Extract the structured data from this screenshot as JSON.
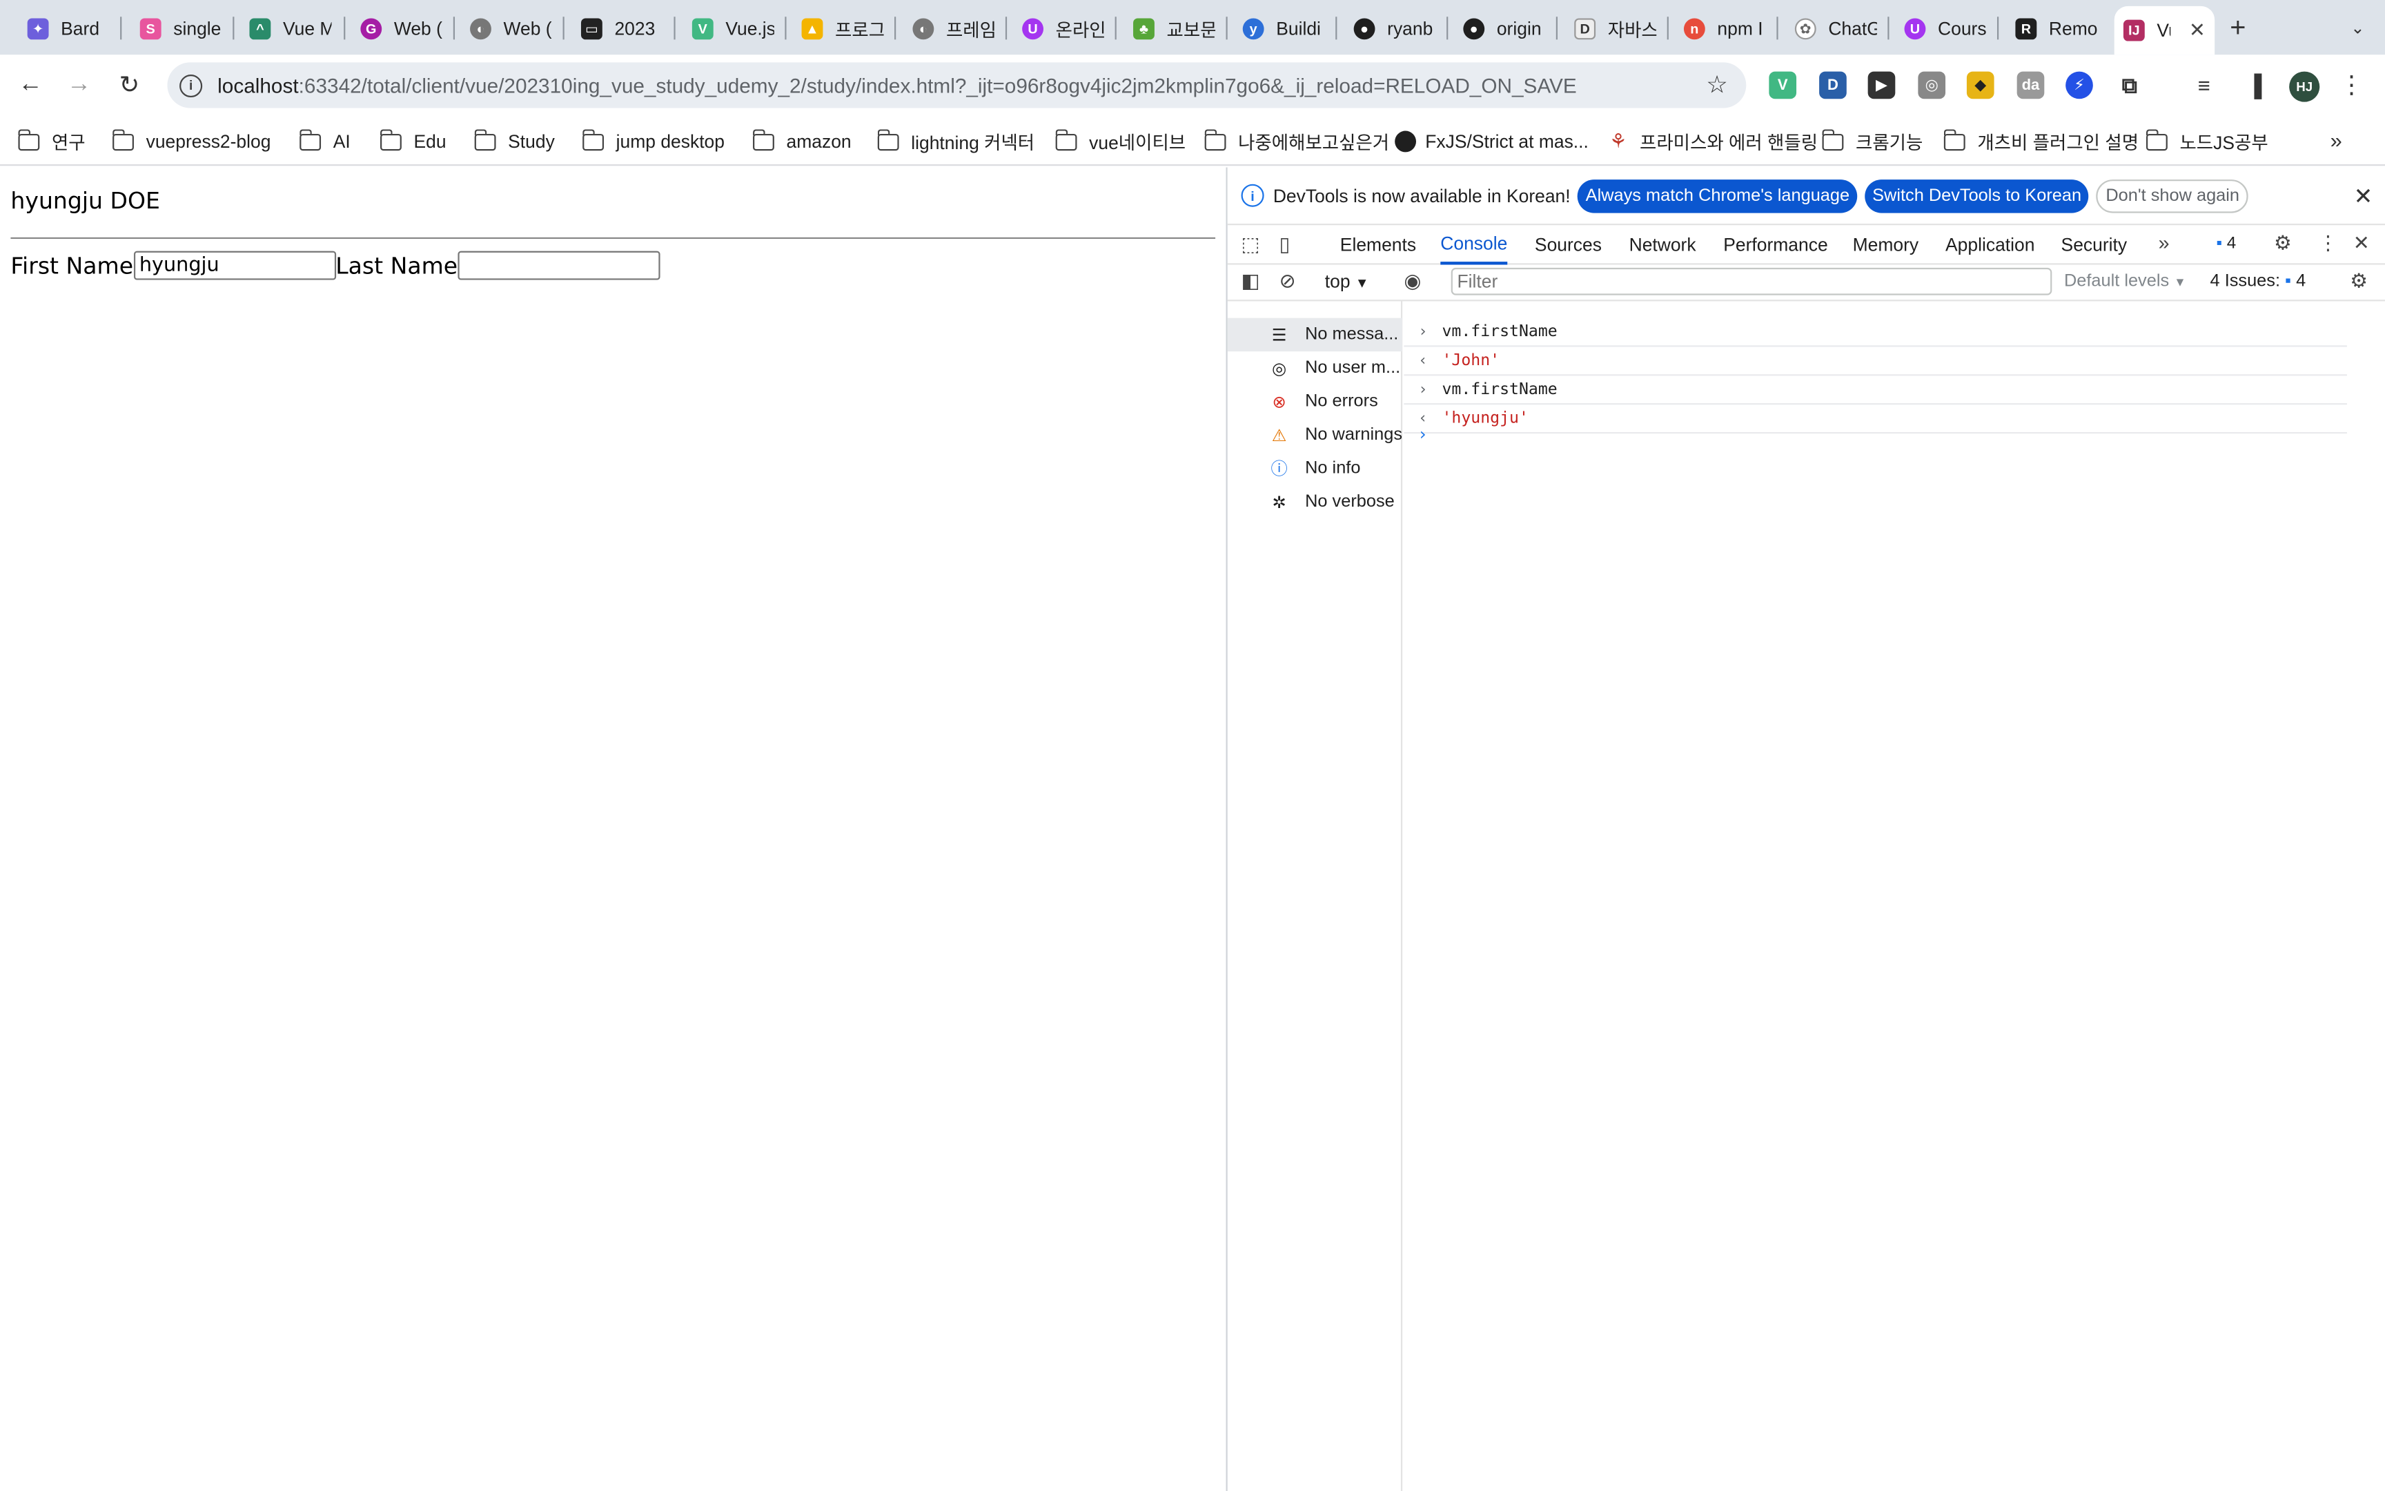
{
  "browser": {
    "tabs": [
      {
        "label": "Bard",
        "icon": "bard-icon",
        "color": "#6d5fdc"
      },
      {
        "label": "single",
        "icon": "single-spa-icon",
        "color": "#e8559e"
      },
      {
        "label": "Vue M",
        "icon": "vue-mastery-icon",
        "color": "#2a8b6a"
      },
      {
        "label": "Web (",
        "icon": "g-icon",
        "color": "#a51da5"
      },
      {
        "label": "Web (",
        "icon": "globe-icon",
        "color": "#777777"
      },
      {
        "label": "2023",
        "icon": "monitor-icon",
        "color": "#222222"
      },
      {
        "label": "Vue.js",
        "icon": "vue-icon",
        "color": "#41b883"
      },
      {
        "label": "프로그",
        "icon": "drive-icon",
        "color": "#f4b400"
      },
      {
        "label": "프레임",
        "icon": "globe-icon",
        "color": "#777777"
      },
      {
        "label": "온라인",
        "icon": "udemy-icon",
        "color": "#a435f0"
      },
      {
        "label": "교보문",
        "icon": "kyobo-icon",
        "color": "#57a639"
      },
      {
        "label": "Buildi",
        "icon": "y-icon",
        "color": "#2d6fd8"
      },
      {
        "label": "ryanb",
        "icon": "github-icon",
        "color": "#1f1f1f"
      },
      {
        "label": "origin",
        "icon": "github-icon",
        "color": "#1f1f1f"
      },
      {
        "label": "자바스",
        "icon": "dale-icon",
        "color": "#999999"
      },
      {
        "label": "npm I",
        "icon": "npm-icon",
        "color": "#e74c3c"
      },
      {
        "label": "ChatG",
        "icon": "chatgpt-icon",
        "color": "#888888"
      },
      {
        "label": "Cours",
        "icon": "udemy-icon",
        "color": "#a435f0"
      },
      {
        "label": "Remo",
        "icon": "r-icon",
        "color": "#1f1f1f"
      },
      {
        "label": "Vu",
        "icon": "intellij-icon",
        "color": "#b32e63"
      }
    ],
    "address": {
      "host": "localhost",
      "path": ":63342/total/client/vue/202310ing_vue_study_udemy_2/study/index.html?_ijt=o96r8ogv4jic2jm2kmplin7go6&_ij_reload=RELOAD_ON_SAVE"
    },
    "bookmarks": [
      {
        "label": "연구",
        "type": "folder"
      },
      {
        "label": "vuepress2-blog",
        "type": "folder"
      },
      {
        "label": "AI",
        "type": "folder"
      },
      {
        "label": "Edu",
        "type": "folder"
      },
      {
        "label": "Study",
        "type": "folder"
      },
      {
        "label": "jump desktop",
        "type": "folder"
      },
      {
        "label": "amazon",
        "type": "folder"
      },
      {
        "label": "lightning 커넥터",
        "type": "folder"
      },
      {
        "label": "vue네이티브",
        "type": "folder"
      },
      {
        "label": "나중에해보고싶은거",
        "type": "folder"
      },
      {
        "label": "FxJS/Strict at mas...",
        "type": "github"
      },
      {
        "label": "프라미스와 에러 핸들링",
        "type": "link"
      },
      {
        "label": "크롬기능",
        "type": "folder"
      },
      {
        "label": "개츠비 플러그인 설명",
        "type": "folder"
      },
      {
        "label": "노드JS공부",
        "type": "folder"
      }
    ],
    "profile_initials": "HJ"
  },
  "page": {
    "heading": "hyungju DOE",
    "first_name_label": "First Name",
    "first_name_value": "hyungju",
    "last_name_label": "Last Name",
    "last_name_value": ""
  },
  "devtools": {
    "infobar": {
      "message": "DevTools is now available in Korean!",
      "btn_match": "Always match Chrome's language",
      "btn_switch": "Switch DevTools to Korean",
      "btn_dont_show": "Don't show again"
    },
    "tabs": [
      "Elements",
      "Console",
      "Sources",
      "Network",
      "Performance",
      "Memory",
      "Application",
      "Security"
    ],
    "active_tab": "Console",
    "issues_badge": "4",
    "console_toolbar": {
      "context": "top",
      "filter_placeholder": "Filter",
      "levels": "Default levels",
      "issues_label": "4 Issues:",
      "issues_count": "4"
    },
    "sidebar": [
      {
        "label": "No messa...",
        "icon": "list-icon"
      },
      {
        "label": "No user m...",
        "icon": "user-icon"
      },
      {
        "label": "No errors",
        "icon": "error-icon"
      },
      {
        "label": "No warnings",
        "icon": "warning-icon"
      },
      {
        "label": "No info",
        "icon": "info-icon"
      },
      {
        "label": "No verbose",
        "icon": "bug-icon"
      }
    ],
    "console_lines": [
      {
        "kind": "input",
        "text": "vm.firstName"
      },
      {
        "kind": "output",
        "text": "'John'"
      },
      {
        "kind": "input",
        "text": "vm.firstName"
      },
      {
        "kind": "output",
        "text": "'hyungju'"
      }
    ]
  }
}
